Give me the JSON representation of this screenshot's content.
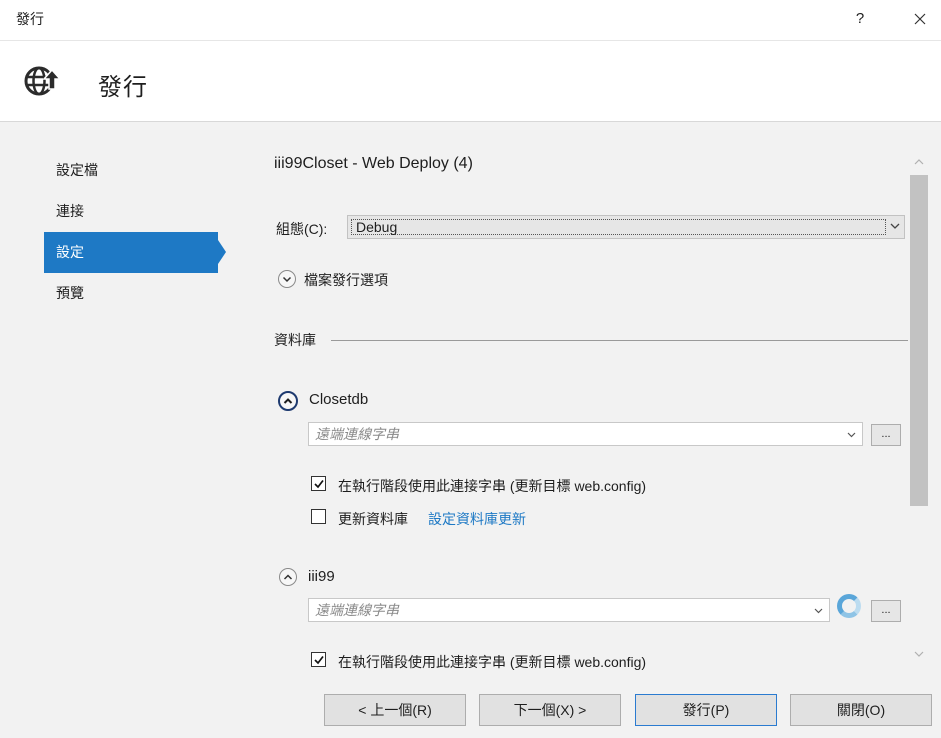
{
  "window": {
    "title": "發行",
    "help_label": "?"
  },
  "header": {
    "title": "發行",
    "icon": "globe-publish-icon"
  },
  "nav": {
    "items": [
      {
        "label": "設定檔",
        "active": false
      },
      {
        "label": "連接",
        "active": false
      },
      {
        "label": "設定",
        "active": true
      },
      {
        "label": "預覽",
        "active": false
      }
    ]
  },
  "main": {
    "profile_title": "iii99Closet - Web Deploy (4)",
    "configuration": {
      "label": "組態(C):",
      "value": "Debug"
    },
    "file_publish_options": "檔案發行選項",
    "databases_section": "資料庫",
    "databases": [
      {
        "name": "Closetdb",
        "connection_placeholder": "遠端連線字串",
        "use_at_runtime_label": "在執行階段使用此連接字串 (更新目標 web.config)",
        "use_at_runtime_checked": true,
        "update_db_label": "更新資料庫",
        "update_db_link": "設定資料庫更新",
        "update_db_checked": false,
        "ellipsis": "..."
      },
      {
        "name": "iii99",
        "connection_placeholder": "遠端連線字串",
        "use_at_runtime_label": "在執行階段使用此連接字串 (更新目標 web.config)",
        "use_at_runtime_checked": true,
        "ellipsis": "..."
      }
    ]
  },
  "footer": {
    "prev": "< 上一個(R)",
    "next": "下一個(X) >",
    "publish": "發行(P)",
    "close": "關閉(O)"
  },
  "colors": {
    "accent": "#1e79c5",
    "background": "#f2f2f2"
  }
}
